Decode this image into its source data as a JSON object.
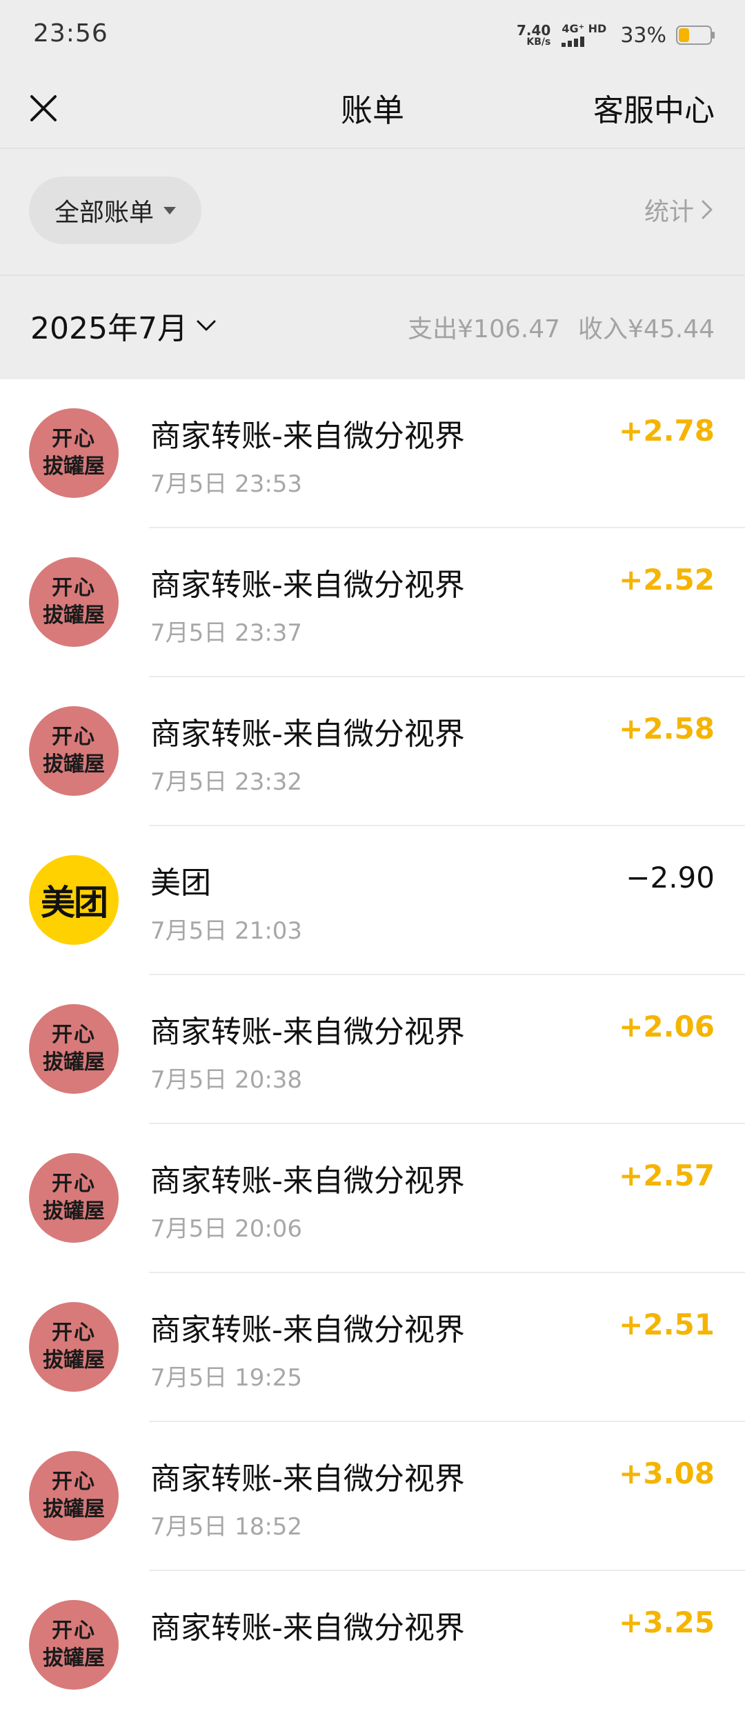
{
  "status_bar": {
    "time": "23:56",
    "net_speed": "7.40",
    "net_unit": "KB/s",
    "network_label": "4G⁺ HD",
    "battery": "33%",
    "battery_level": 0.33,
    "battery_color": "#f5b400"
  },
  "header": {
    "title": "账单",
    "right_link": "客服中心",
    "close_icon": "close-icon"
  },
  "filter": {
    "pill_label": "全部账单",
    "stats_label": "统计"
  },
  "month": {
    "label": "2025年7月",
    "expense_label": "支出¥106.47",
    "income_label": "收入¥45.44"
  },
  "transactions": [
    {
      "type": "shop",
      "avatar_line1": "开心",
      "avatar_line2": "拔罐屋",
      "title": "商家转账-来自微分视界",
      "time": "7月5日 23:53",
      "amount": "+2.78",
      "kind": "income"
    },
    {
      "type": "shop",
      "avatar_line1": "开心",
      "avatar_line2": "拔罐屋",
      "title": "商家转账-来自微分视界",
      "time": "7月5日 23:37",
      "amount": "+2.52",
      "kind": "income"
    },
    {
      "type": "shop",
      "avatar_line1": "开心",
      "avatar_line2": "拔罐屋",
      "title": "商家转账-来自微分视界",
      "time": "7月5日 23:32",
      "amount": "+2.58",
      "kind": "income"
    },
    {
      "type": "meituan",
      "avatar_text": "美团",
      "title": "美团",
      "time": "7月5日 21:03",
      "amount": "−2.90",
      "kind": "expense"
    },
    {
      "type": "shop",
      "avatar_line1": "开心",
      "avatar_line2": "拔罐屋",
      "title": "商家转账-来自微分视界",
      "time": "7月5日 20:38",
      "amount": "+2.06",
      "kind": "income"
    },
    {
      "type": "shop",
      "avatar_line1": "开心",
      "avatar_line2": "拔罐屋",
      "title": "商家转账-来自微分视界",
      "time": "7月5日 20:06",
      "amount": "+2.57",
      "kind": "income"
    },
    {
      "type": "shop",
      "avatar_line1": "开心",
      "avatar_line2": "拔罐屋",
      "title": "商家转账-来自微分视界",
      "time": "7月5日 19:25",
      "amount": "+2.51",
      "kind": "income"
    },
    {
      "type": "shop",
      "avatar_line1": "开心",
      "avatar_line2": "拔罐屋",
      "title": "商家转账-来自微分视界",
      "time": "7月5日 18:52",
      "amount": "+3.08",
      "kind": "income"
    },
    {
      "type": "shop",
      "avatar_line1": "开心",
      "avatar_line2": "拔罐屋",
      "title": "商家转账-来自微分视界",
      "time": "",
      "amount": "+3.25",
      "kind": "income"
    }
  ],
  "colors": {
    "income": "#f5b400",
    "expense": "#111111",
    "shop_avatar": "#d87a7a",
    "meituan_avatar": "#ffd100"
  }
}
